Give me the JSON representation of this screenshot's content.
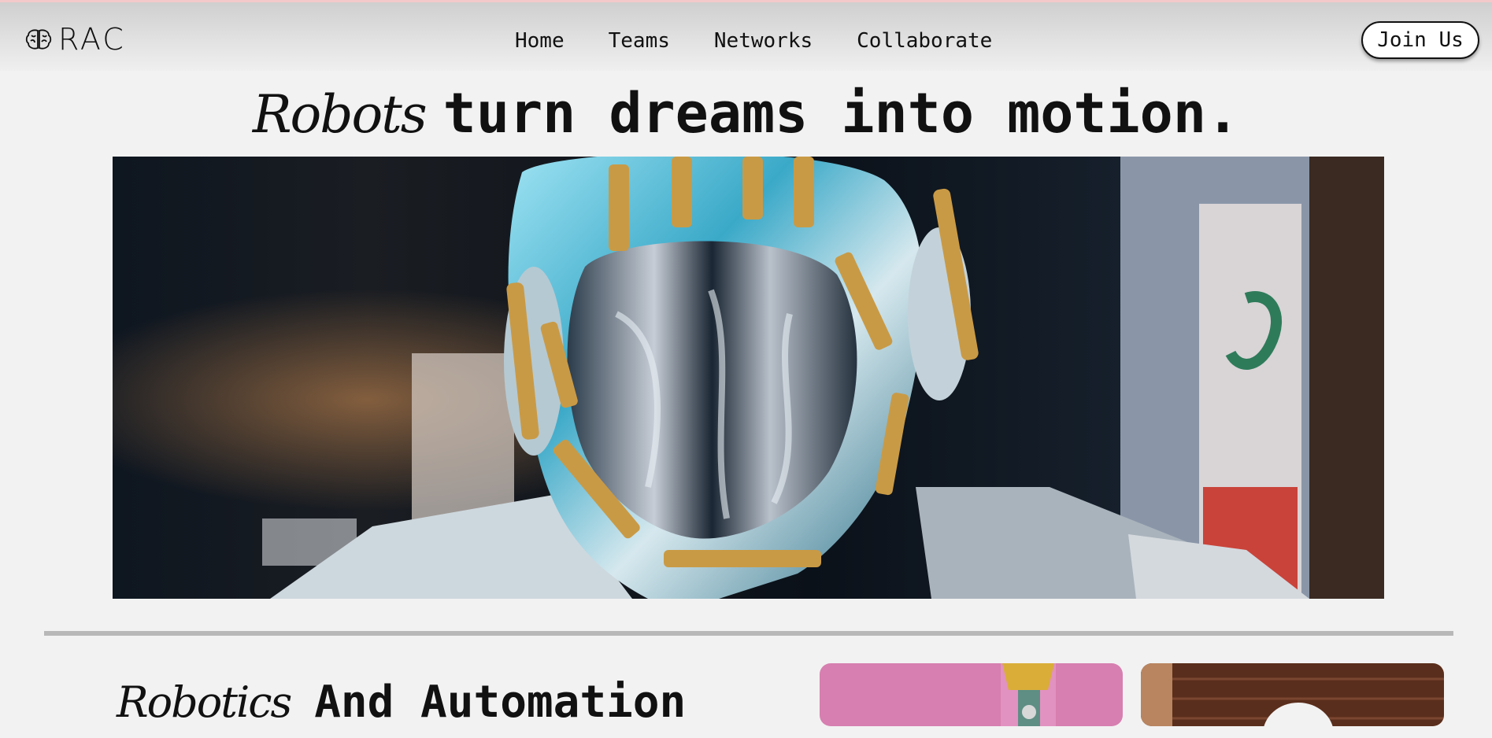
{
  "header": {
    "logo_text": "RAC",
    "nav": [
      "Home",
      "Teams",
      "Networks",
      "Collaborate"
    ],
    "join_label": "Join Us"
  },
  "hero": {
    "script_word": "Robots",
    "headline": "turn dreams into motion."
  },
  "section": {
    "script_word": "Robotics",
    "title": "And Automation"
  },
  "icons": {
    "logo_icon": "brain-icon"
  },
  "colors": {
    "background": "#f2f2f2",
    "divider": "#b8b8b8",
    "card_pink": "#d77fb0"
  }
}
